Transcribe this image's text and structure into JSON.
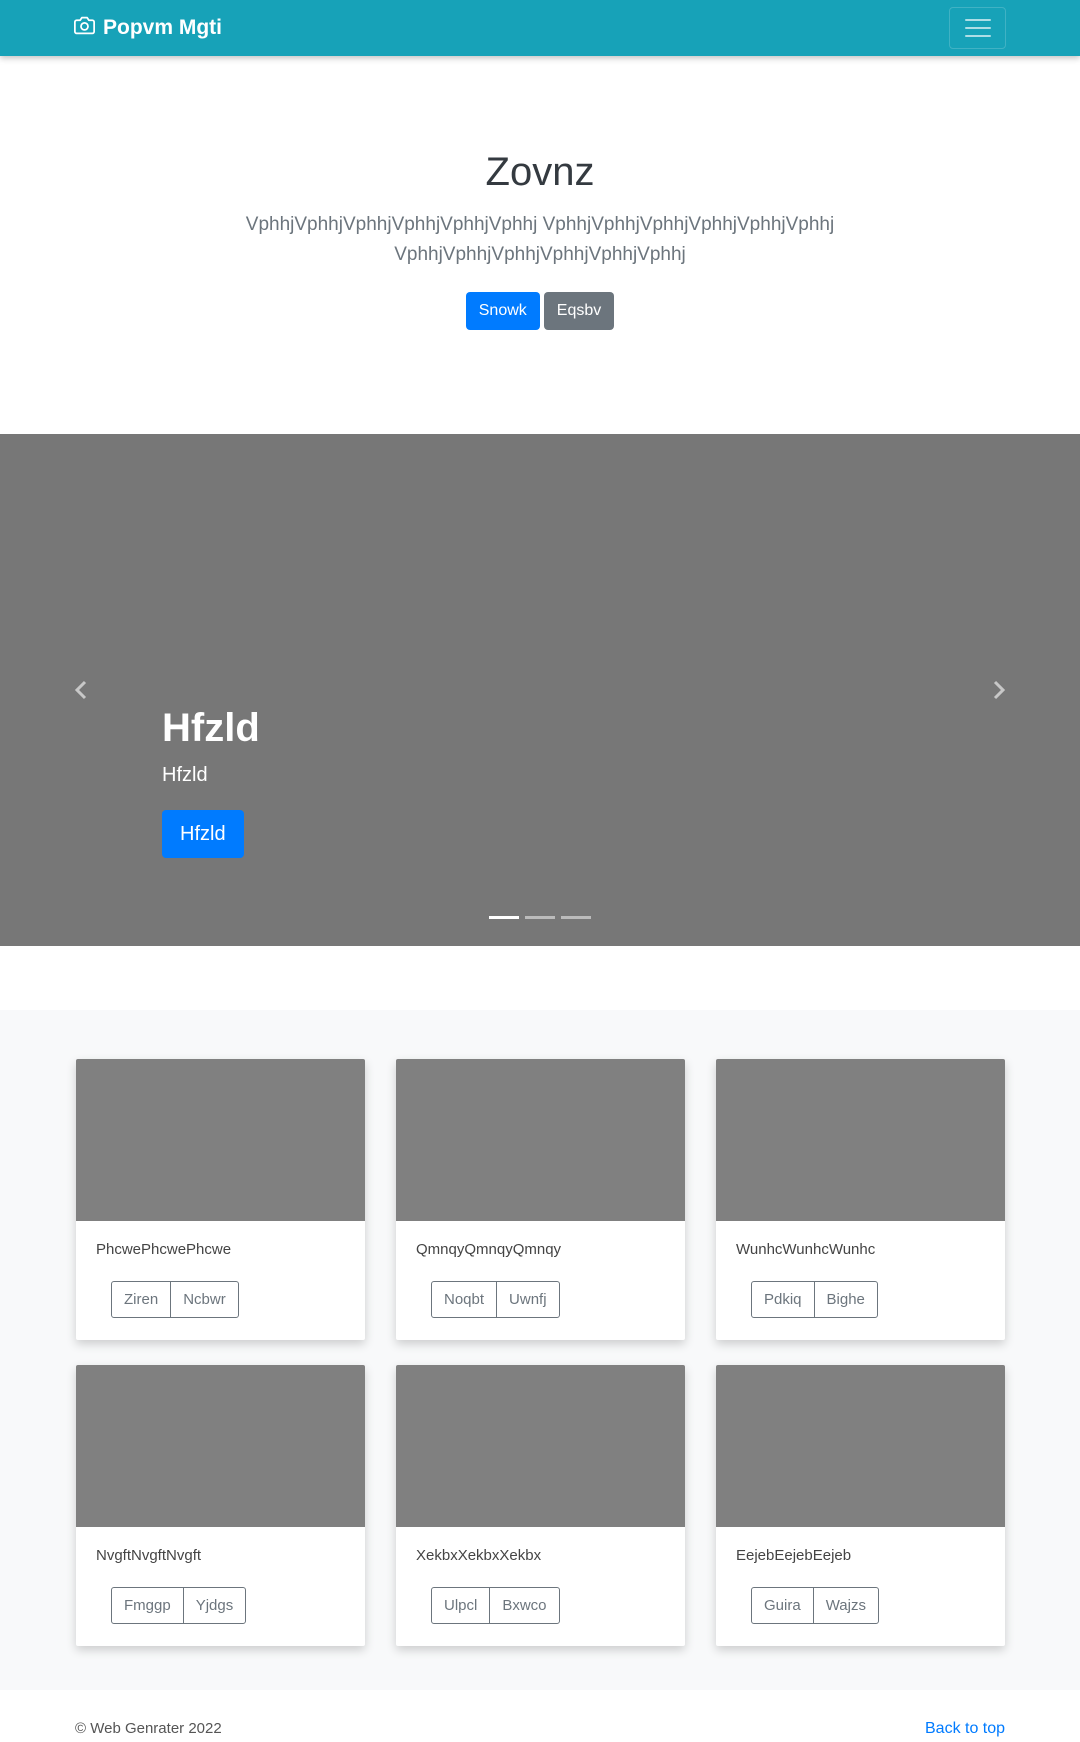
{
  "navbar": {
    "brand": "Popvm Mgti",
    "brand_icon": "camera-icon"
  },
  "hero": {
    "title": "Zovnz",
    "lead": "VphhjVphhjVphhjVphhjVphhjVphhj VphhjVphhjVphhjVphhjVphhjVphhj VphhjVphhjVphhjVphhjVphhjVphhj",
    "primary_button": "Snowk",
    "secondary_button": "Eqsbv"
  },
  "carousel": {
    "heading": "Hfzld",
    "text": "Hfzld",
    "button": "Hfzld",
    "slides": 3,
    "active_slide": 1
  },
  "album": {
    "cards": [
      {
        "text": "PhcwePhcwePhcwe",
        "btn1": "Ziren",
        "btn2": "Ncbwr"
      },
      {
        "text": "QmnqyQmnqyQmnqy",
        "btn1": "Noqbt",
        "btn2": "Uwnfj"
      },
      {
        "text": "WunhcWunhcWunhc",
        "btn1": "Pdkiq",
        "btn2": "Bighe"
      },
      {
        "text": "NvgftNvgftNvgft",
        "btn1": "Fmggp",
        "btn2": "Yjdgs"
      },
      {
        "text": "XekbxXekbxXekbx",
        "btn1": "Ulpcl",
        "btn2": "Bxwco"
      },
      {
        "text": "EejebEejebEejeb",
        "btn1": "Guira",
        "btn2": "Wajzs"
      }
    ]
  },
  "footer": {
    "copyright": "© Web Genrater 2022",
    "back_to_top": "Back to top"
  },
  "colors": {
    "navbar": "#17a2b8",
    "primary": "#007bff",
    "secondary": "#6c757d",
    "placeholder": "#808080"
  }
}
